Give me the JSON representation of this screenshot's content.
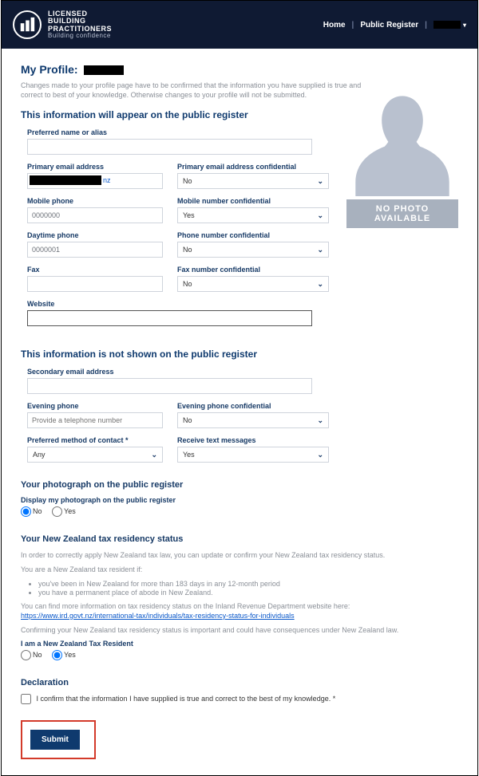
{
  "brand": {
    "line1": "LICENSED",
    "line2": "BUILDING",
    "line3": "PRACTITIONERS",
    "tagline": "Building confidence"
  },
  "nav": {
    "home": "Home",
    "register": "Public Register"
  },
  "profile": {
    "title_prefix": "My Profile:",
    "intro": "Changes made to your profile page have to be confirmed that the information you have supplied is true and correct to best of your knowledge. Otherwise changes to your profile will not be submitted."
  },
  "section_public": "This information will appear on the public register",
  "section_private": "This information is not shown on the public register",
  "photo_caption": "NO PHOTO AVAILABLE",
  "fields": {
    "preferred_name": {
      "label": "Preferred name or alias",
      "value": ""
    },
    "primary_email": {
      "label": "Primary email address",
      "suffix": "nz"
    },
    "primary_email_conf": {
      "label": "Primary email address confidential",
      "value": "No"
    },
    "mobile": {
      "label": "Mobile phone",
      "value": "0000000"
    },
    "mobile_conf": {
      "label": "Mobile number confidential",
      "value": "Yes"
    },
    "daytime": {
      "label": "Daytime phone",
      "value": "0000001"
    },
    "phone_conf": {
      "label": "Phone number confidential",
      "value": "No"
    },
    "fax": {
      "label": "Fax",
      "value": ""
    },
    "fax_conf": {
      "label": "Fax number confidential",
      "value": "No"
    },
    "website": {
      "label": "Website",
      "value": ""
    },
    "secondary_email": {
      "label": "Secondary email address",
      "value": ""
    },
    "evening": {
      "label": "Evening phone",
      "placeholder": "Provide a telephone number"
    },
    "evening_conf": {
      "label": "Evening phone confidential",
      "value": "No"
    },
    "contact_method": {
      "label": "Preferred method of contact *",
      "value": "Any"
    },
    "receive_txt": {
      "label": "Receive text messages",
      "value": "Yes"
    }
  },
  "photo_section": {
    "heading": "Your photograph on the public register",
    "question": "Display my photograph on the public register",
    "no": "No",
    "yes": "Yes",
    "selected": "No"
  },
  "tax_section": {
    "heading": "Your New Zealand tax residency status",
    "p1": "In order to correctly apply New Zealand tax law, you can update or confirm your New Zealand tax residency status.",
    "p2": "You are a New Zealand tax resident if:",
    "b1": "you've been in New Zealand for more than 183 days in any 12-month period",
    "b2": "you have a permanent place of abode in New Zealand.",
    "p3_pre": "You can find more information on tax residency status on the Inland Revenue Department website here: ",
    "p3_link": "https://www.ird.govt.nz/international-tax/individuals/tax-residency-status-for-individuals",
    "p4": "Confirming your New Zealand tax residency status is important and could have consequences under New Zealand law.",
    "question": "I am a New Zealand Tax Resident",
    "no": "No",
    "yes": "Yes",
    "selected": "Yes"
  },
  "declaration": {
    "heading": "Declaration",
    "text": "I confirm that the information I have supplied is true and correct to the best of my knowledge. *"
  },
  "submit_label": "Submit"
}
